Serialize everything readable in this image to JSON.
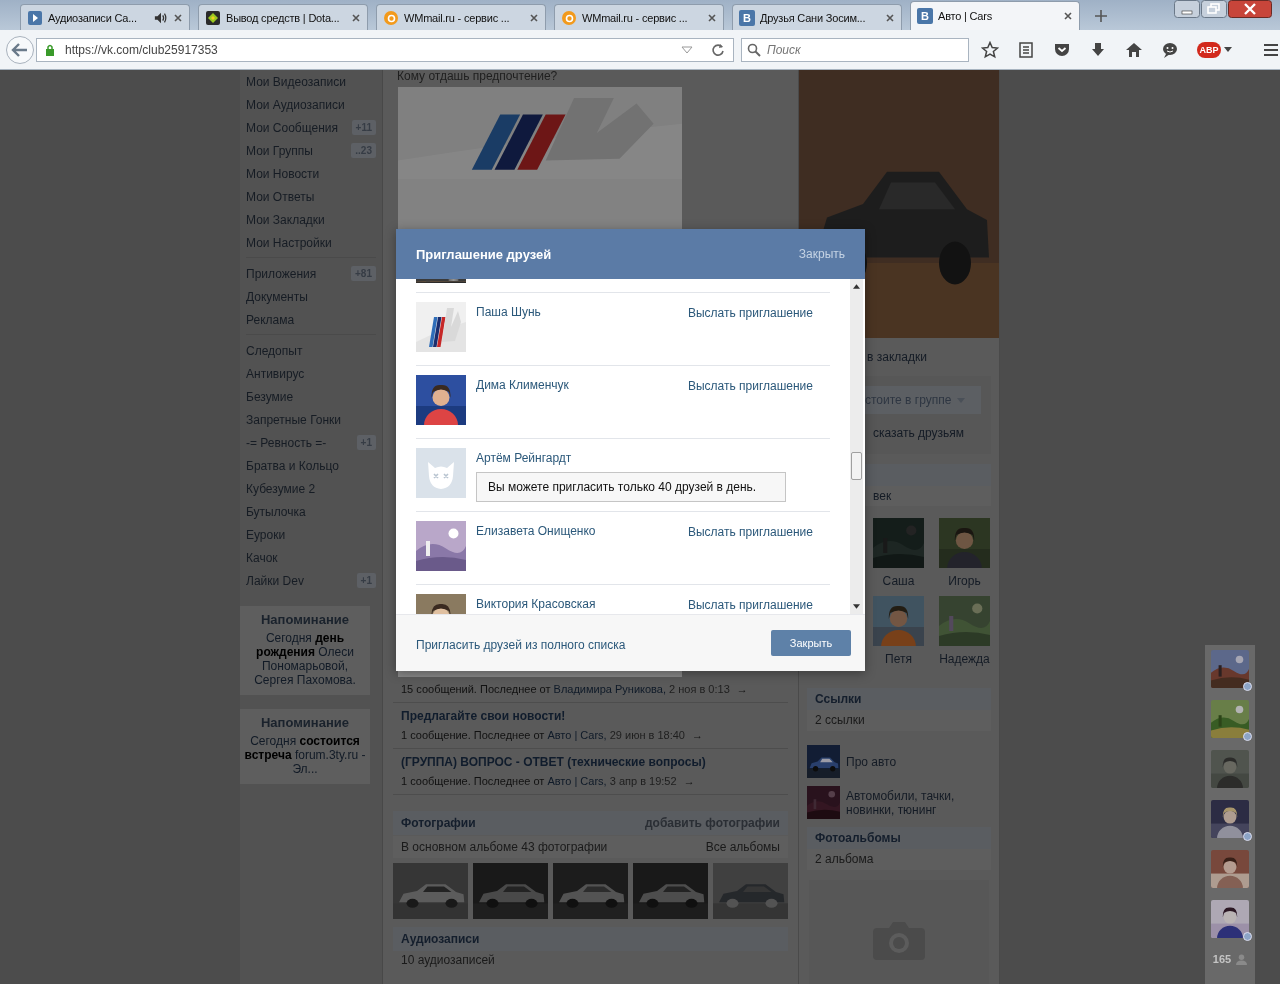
{
  "browser": {
    "tabs": [
      {
        "title": "Аудиозаписи Са...",
        "kind": "play",
        "selected": false,
        "playing": true
      },
      {
        "title": "Вывод средств | Dota...",
        "kind": "diamond",
        "selected": false,
        "playing": false
      },
      {
        "title": "WMmail.ru - сервис ...",
        "kind": "circle",
        "selected": false,
        "playing": false
      },
      {
        "title": "WMmail.ru - сервис ...",
        "kind": "circle",
        "selected": false,
        "playing": false
      },
      {
        "title": "Друзья Сани Зосим...",
        "kind": "letter",
        "icon_letter": "В",
        "selected": false,
        "playing": false
      },
      {
        "title": "Авто | Cars",
        "kind": "letter",
        "icon_letter": "В",
        "selected": true,
        "playing": false
      }
    ],
    "url": "https://vk.com/club25917353",
    "search_placeholder": "Поиск",
    "abp_label": "ABP"
  },
  "sidebar": {
    "groups": [
      [
        {
          "label": "Мои Видеозаписи"
        },
        {
          "label": "Мои Аудиозаписи"
        },
        {
          "label": "Мои Сообщения",
          "count": "+11"
        },
        {
          "label": "Мои Группы",
          "count": "..23"
        },
        {
          "label": "Мои Новости"
        },
        {
          "label": "Мои Ответы"
        },
        {
          "label": "Мои Закладки"
        },
        {
          "label": "Мои Настройки"
        }
      ],
      [
        {
          "label": "Приложения",
          "count": "+81"
        },
        {
          "label": "Документы"
        },
        {
          "label": "Реклама"
        }
      ],
      [
        {
          "label": "Следопыт"
        },
        {
          "label": "Антивирус"
        },
        {
          "label": "Безумие"
        },
        {
          "label": "Запретные Гонки"
        },
        {
          "label": "-= Ревность =-",
          "count": "+1"
        },
        {
          "label": "Братва и Кольцо"
        },
        {
          "label": "Кубезумие 2"
        },
        {
          "label": "Бутылочка"
        },
        {
          "label": "Еуроки"
        },
        {
          "label": "Качок"
        },
        {
          "label": "Лайки Dev",
          "count": "+1"
        }
      ]
    ],
    "reminders": [
      {
        "title": "Напоминание",
        "text": "Сегодня **день рождения** Олеси Пономарьовой, Сергея Пахомова."
      },
      {
        "title": "Напоминание",
        "text": "Сегодня **состоится встреча** forum.3ty.ru - Эл..."
      }
    ]
  },
  "main": {
    "poll_question": "Кому отдашь предпочтение?",
    "topics": [
      {
        "meta": "15 сообщений. Последнее от",
        "author": "Владимира Руникова,",
        "date": "2 ноя в 0:13",
        "arrow": "→"
      },
      {
        "title": "Предлагайте свои новости!",
        "meta": "1 сообщение. Последнее от",
        "author": "Авто | Cars,",
        "date": "29 июн в 18:40",
        "arrow": "→"
      },
      {
        "title": "(ГРУППА) ВОПРОС - ОТВЕТ (технические вопросы)",
        "meta": "1 сообщение. Последнее от",
        "author": "Авто | Cars,",
        "date": "3 апр в 19:52",
        "arrow": "→"
      }
    ],
    "photos": {
      "title": "Фотографии",
      "action": "добавить фотографии",
      "summary": "В основном альбоме 43 фотографии",
      "all_link": "Все альбомы"
    },
    "audio": {
      "title": "Аудиозаписи",
      "summary": "10 аудиозаписей"
    }
  },
  "right": {
    "bookmark": "в закладки",
    "member_button": "стоите в группе",
    "share": "сказать друзьям",
    "members_count": "век",
    "members": [
      {
        "name": "Саша"
      },
      {
        "name": "Игорь"
      },
      {
        "name": "Петя"
      },
      {
        "name": "Надежда"
      }
    ],
    "links": {
      "title": "Ссылки",
      "count": "2 ссылки",
      "items": [
        {
          "label": "Про авто"
        },
        {
          "label": "Автомобили, тачки, новинки, тюнинг"
        }
      ]
    },
    "albums": {
      "title": "Фотоальбомы",
      "count": "2 альбома"
    }
  },
  "modal": {
    "title": "Приглашение друзей",
    "close_link": "Закрыть",
    "friends": [
      {
        "name": "Паша Шунь",
        "kind": "invite",
        "action": "Выслать приглашение"
      },
      {
        "name": "Дима Клименчук",
        "kind": "invite",
        "action": "Выслать приглашение"
      },
      {
        "name": "Артём Рейнгардт",
        "kind": "limited",
        "notice": "Вы можете пригласить только 40 друзей в день."
      },
      {
        "name": "Елизавета Онищенко",
        "kind": "invite",
        "action": "Выслать приглашение"
      },
      {
        "name": "Виктория Красовская",
        "kind": "invite",
        "action": "Выслать приглашение"
      }
    ],
    "footer_link": "Пригласить друзей из полного списка",
    "close_button": "Закрыть"
  },
  "chat_bar": {
    "contacts": [
      {
        "online": true
      },
      {
        "online": true
      },
      {
        "online": false
      },
      {
        "online": true
      },
      {
        "online": false
      },
      {
        "online": true
      }
    ],
    "count": "165"
  }
}
